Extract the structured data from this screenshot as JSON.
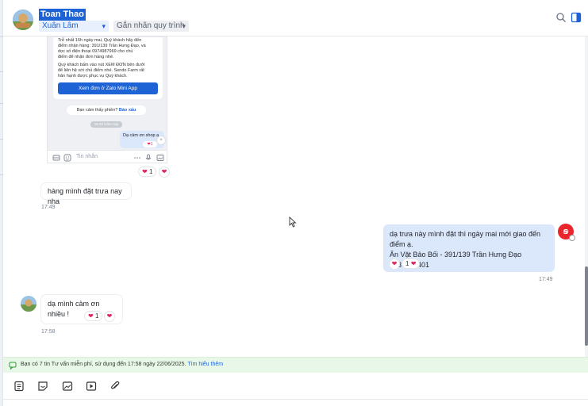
{
  "header": {
    "contact_name": "Toan Thao",
    "area_select": "Xuân Lâm",
    "tag_select": "Gắn nhãn quy trình"
  },
  "embedded_screenshot": {
    "line1": "Trễ nhất 16h ngày mai, Quý khách hãy đến",
    "line2": "điểm nhận hàng: 391/139 Trần Hưng Đạo, và",
    "line3": "dọc số điện thoại 0974987969 cho chủ",
    "line4": "điểm để nhận đơn hàng nhé.",
    "line5": "Quý khách bấm vào nút XEM ĐƠN bên dưới",
    "line6": "để liên hệ với chủ điểm nhé. Sendo Farm rất",
    "line7": "hân hạnh được phục vụ Quý khách.",
    "button": "Xem đơn ở Zalo Mini App",
    "feedback_q": "Bạn cảm thấy phiền?",
    "feedback_link": "Báo xấu",
    "time_chip": "16:22 Hôm nay",
    "bubble_text": "Dạ cảm ơn shop ạ",
    "bubble_reaction": "1",
    "input_placeholder": "Tin nhắn"
  },
  "messages": [
    {
      "text": "hàng mình đặt trưa nay nha",
      "time": "17:49"
    },
    {
      "text_line1": "dạ trưa này mình đặt thì ngày mai mới giao đến điểm ạ.",
      "text_line2": "Ăn Vặt Bảo Bối - 391/139 Trần Hưng Đạo",
      "text_line3": "0937464401",
      "time": "17:49",
      "reaction_count": "1"
    },
    {
      "text": "dạ mình cảm ơn nhiều !",
      "time": "17:58",
      "reaction_count": "1"
    }
  ],
  "screenshot_reaction_count": "1",
  "notice": {
    "text": "Bạn có 7 tin Tư vấn miễn phí, sử dụng đến 17:58 ngày 22/06/2025.",
    "link": "Tìm hiểu thêm"
  },
  "colors": {
    "accent": "#1e63d6",
    "outgoing_bubble": "#dbe7fb",
    "notice_bg": "#e9f7e8",
    "heart": "#e0245e"
  }
}
